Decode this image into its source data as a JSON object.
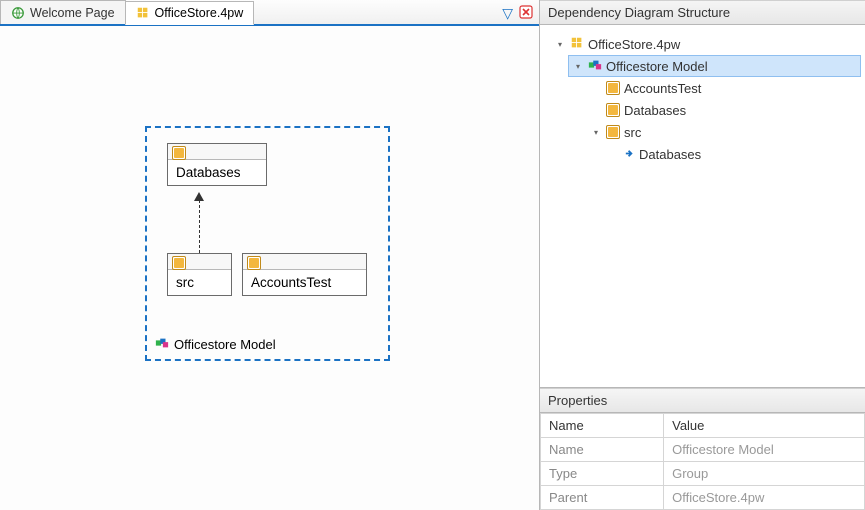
{
  "tabs": {
    "welcome": "Welcome Page",
    "active": "OfficeStore.4pw"
  },
  "diagram": {
    "group_label": "Officestore Model",
    "nodes": {
      "databases": "Databases",
      "src": "src",
      "accountstest": "AccountsTest"
    }
  },
  "structure": {
    "title": "Dependency Diagram Structure",
    "root": "OfficeStore.4pw",
    "model": "Officestore Model",
    "children": {
      "accountstest": "AccountsTest",
      "databases": "Databases",
      "src": "src",
      "src_databases": "Databases"
    }
  },
  "properties": {
    "title": "Properties",
    "headers": {
      "name": "Name",
      "value": "Value"
    },
    "rows": {
      "name_label": "Name",
      "name_value": "Officestore Model",
      "type_label": "Type",
      "type_value": "Group",
      "parent_label": "Parent",
      "parent_value": "OfficeStore.4pw"
    }
  }
}
